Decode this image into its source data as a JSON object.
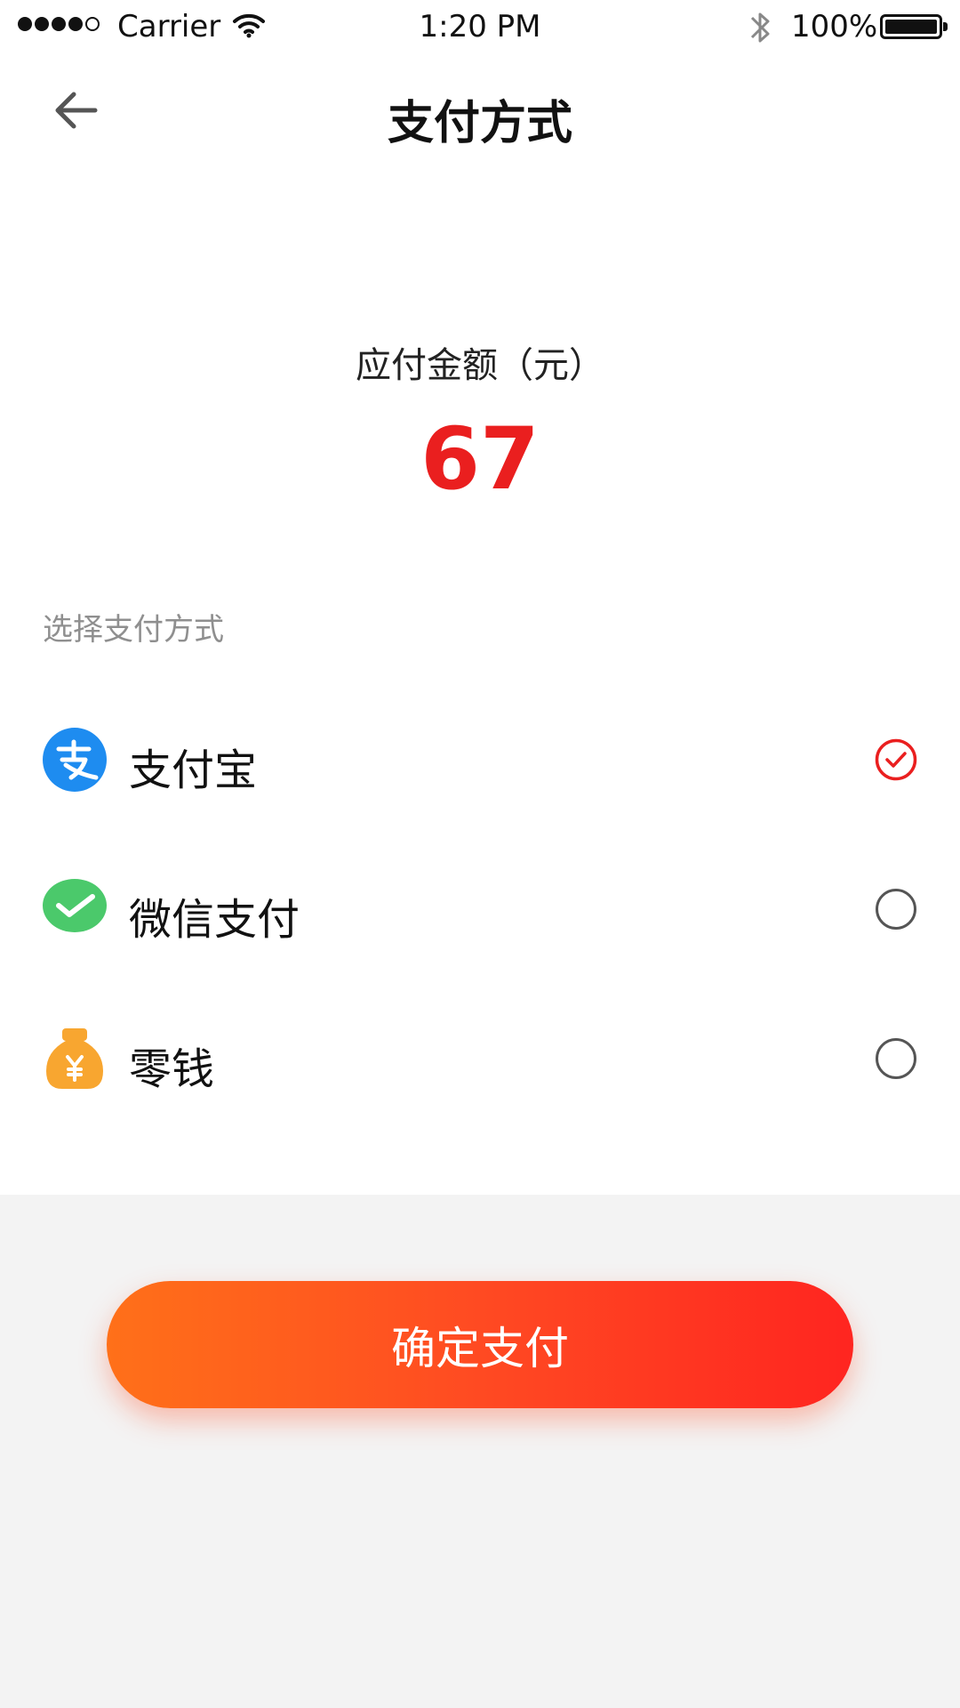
{
  "status_bar": {
    "carrier": "Carrier",
    "time": "1:20 PM",
    "battery": "100%"
  },
  "nav": {
    "title": "支付方式"
  },
  "amount": {
    "label": "应付金额（元）",
    "value": "67"
  },
  "methods": {
    "section_label": "选择支付方式",
    "items": [
      {
        "label": "支付宝",
        "icon": "alipay-icon",
        "selected": true
      },
      {
        "label": "微信支付",
        "icon": "wechat-pay-icon",
        "selected": false
      },
      {
        "label": "零钱",
        "icon": "money-bag-icon",
        "selected": false
      }
    ]
  },
  "confirm_button": {
    "label": "确定支付"
  },
  "colors": {
    "accent_red": "#ea1f1f",
    "gradient_start": "#ff7019",
    "gradient_end": "#ff2520",
    "alipay_blue": "#1e8cf0",
    "wechat_green": "#4bc96b",
    "money_orange": "#f8a630"
  }
}
